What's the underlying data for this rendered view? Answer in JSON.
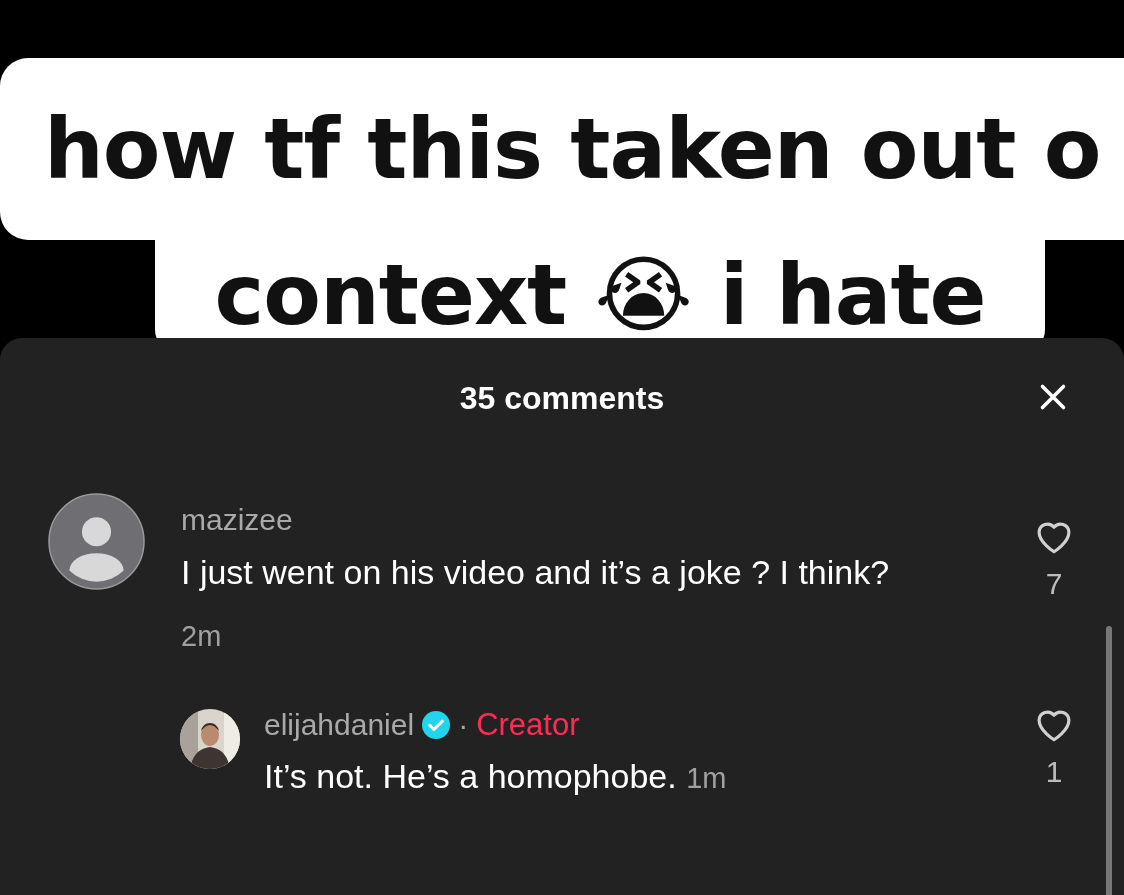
{
  "caption": {
    "lines": [
      "how tf this taken out o",
      "context 😭 i hate"
    ]
  },
  "comments_sheet": {
    "title": "35 comments",
    "comments": [
      {
        "username": "mazizee",
        "text": "I just went on his video and it’s a joke ? I think?",
        "time": "2m",
        "likes": "7",
        "photo_avatar": false,
        "verified": false,
        "children": [
          {
            "username": "elijahdaniel",
            "text": "It’s not. He’s a homophobe.",
            "time": "1m",
            "likes": "1",
            "photo_avatar": true,
            "verified": true,
            "separator": "·",
            "badge": "Creator"
          }
        ]
      }
    ]
  }
}
